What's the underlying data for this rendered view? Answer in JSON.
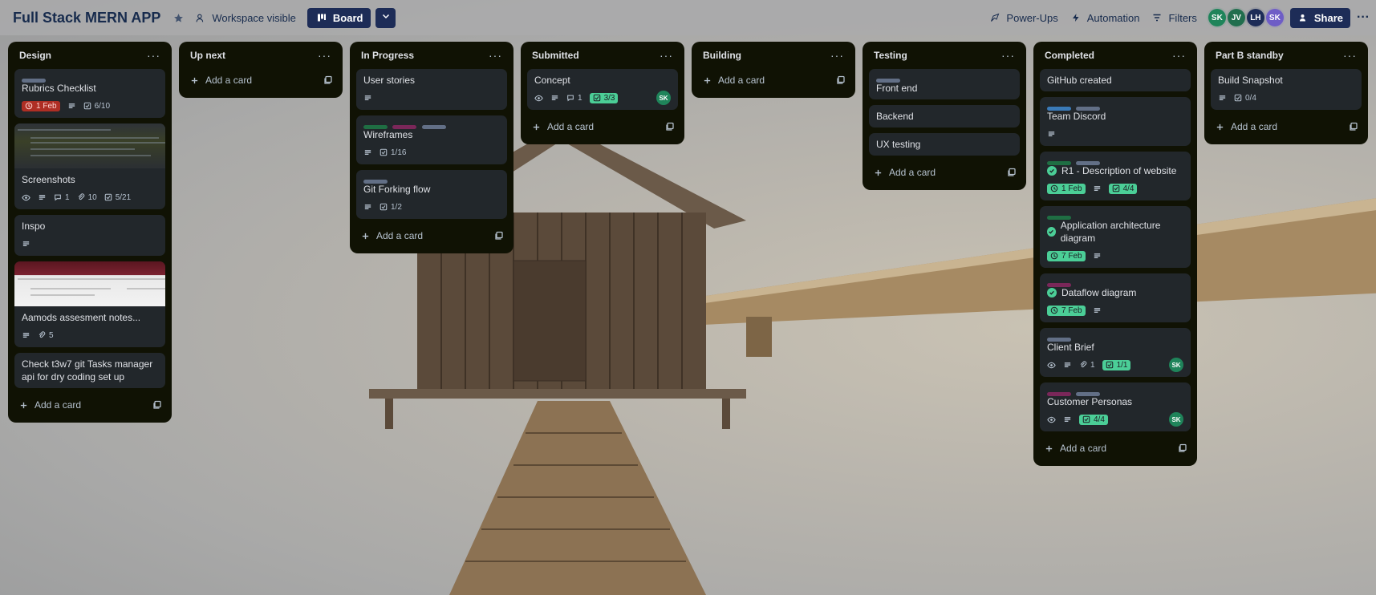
{
  "topbar": {
    "board_title": "Full Stack MERN APP",
    "visibility": "Workspace visible",
    "view": "Board",
    "power_ups": "Power-Ups",
    "automation": "Automation",
    "filters": "Filters",
    "share": "Share",
    "avatars": [
      {
        "initials": "SK",
        "color": "#1f845a"
      },
      {
        "initials": "JV",
        "color": "#216e4e"
      },
      {
        "initials": "LH",
        "color": "#1d2c57"
      },
      {
        "initials": "SK",
        "color": "#6e5dc6"
      }
    ]
  },
  "add_card_label": "Add a card",
  "lists": [
    {
      "title": "Design",
      "cards": [
        {
          "title": "Rubrics Checklist",
          "due": "1 Feb",
          "checklist": "6/10"
        },
        {
          "title": "Screenshots",
          "comments": "1",
          "attachments": "10",
          "checklist": "5/21"
        },
        {
          "title": "Inspo"
        },
        {
          "title": "Aamods assesment notes...",
          "attachments": "5"
        },
        {
          "title": "Check t3w7 git Tasks manager api for dry coding set up"
        }
      ]
    },
    {
      "title": "Up next",
      "cards": []
    },
    {
      "title": "In Progress",
      "cards": [
        {
          "title": "User stories"
        },
        {
          "title": "Wireframes",
          "checklist": "1/16"
        },
        {
          "title": "Git Forking flow",
          "checklist": "1/2"
        }
      ]
    },
    {
      "title": "Submitted",
      "cards": [
        {
          "title": "Concept",
          "comments": "1",
          "checklist": "3/3",
          "member": "SK"
        }
      ]
    },
    {
      "title": "Building",
      "cards": []
    },
    {
      "title": "Testing",
      "cards": [
        {
          "title": "Front end"
        },
        {
          "title": "Backend"
        },
        {
          "title": "UX testing"
        }
      ]
    },
    {
      "title": "Completed",
      "cards": [
        {
          "title": "GitHub created"
        },
        {
          "title": "Team Discord"
        },
        {
          "title": "R1 - Description of website",
          "due": "1 Feb",
          "checklist": "4/4"
        },
        {
          "title": "Application architecture diagram",
          "due": "7 Feb"
        },
        {
          "title": "Dataflow diagram",
          "due": "7 Feb"
        },
        {
          "title": "Client Brief",
          "attachments": "1",
          "checklist": "1/1",
          "member": "SK"
        },
        {
          "title": "Customer Personas",
          "checklist": "4/4",
          "member": "SK"
        }
      ]
    },
    {
      "title": "Part B standby",
      "cards": [
        {
          "title": "Build Snapshot",
          "checklist": "0/4"
        }
      ]
    }
  ],
  "colors": {
    "list_bg": "#101204",
    "card_bg": "#22272b",
    "label_gray": "#626f86",
    "label_green": "#1f6e43",
    "label_magenta": "#7a2759",
    "label_blue": "#3a7ab8",
    "badge_green": "#4bce97",
    "badge_red": "#ae2e24"
  }
}
